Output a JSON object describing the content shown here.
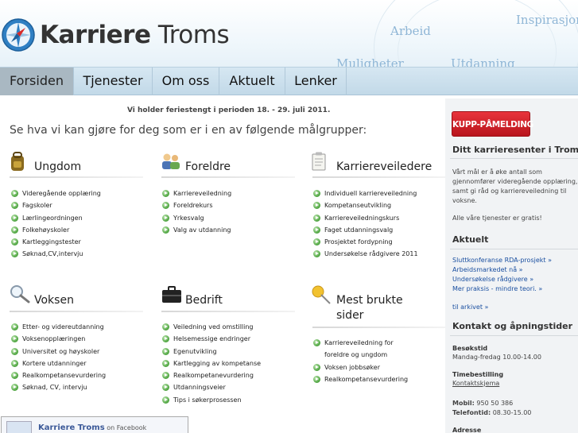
{
  "header": {
    "logo_bold": "Karriere",
    "logo_rest": " Troms",
    "words": [
      "Inspirasjon",
      "Arbeid",
      "Muligheter",
      "Utdanning"
    ]
  },
  "nav": [
    "Forsiden",
    "Tjenester",
    "Om oss",
    "Aktuelt",
    "Lenker"
  ],
  "notice": "Vi holder feriestengt i perioden 18. - 29. juli 2011.",
  "intro": "Se hva vi kan gjøre for deg som er i en av følgende målgrupper:",
  "groups": {
    "ungdom": {
      "title": "Ungdom",
      "icon": "backpack-icon",
      "links": [
        "Videregående opplæring",
        "Fagskoler",
        "Lærlingeordningen",
        "Folkehøyskoler",
        "Kartleggingstester",
        "Søknad,CV,intervju"
      ]
    },
    "foreldre": {
      "title": "Foreldre",
      "icon": "parents-icon",
      "links": [
        "Karriereveiledning",
        "Foreldrekurs",
        "Yrkesvalg",
        "Valg av utdanning"
      ]
    },
    "veiledere": {
      "title": "Karriereveiledere",
      "icon": "clipboard-icon",
      "links": [
        "Individuell karriereveiledning",
        "Kompetanseutvikling",
        "Karriereveiledningskurs",
        "Faget utdanningsvalg",
        "Prosjektet fordypning",
        "Undersøkelse rådgivere 2011"
      ]
    },
    "voksen": {
      "title": "Voksen",
      "icon": "magnifier-icon",
      "links": [
        "Etter- og videreutdanning",
        "Voksenopplæringen",
        "Universitet og høyskoler",
        "Kortere utdanninger",
        "Realkompetansevurdering",
        "Søknad, CV, intervju"
      ]
    },
    "bedrift": {
      "title": "Bedrift",
      "icon": "briefcase-icon",
      "links": [
        "Veiledning ved omstilling",
        "Helsemessige endringer",
        "Egenutvikling",
        "Kartlegging av kompetanse",
        "Realkompetanevurdering",
        "Utdanningsveier",
        "Tips i søkerprosessen"
      ]
    },
    "mest": {
      "title_line1": "Mest brukte",
      "title_line2": "sider",
      "icon": "pushpin-icon",
      "links": [
        "Karriereveiledning for",
        "foreldre og ungdom",
        "Voksen jobbsøker",
        "Realkompetansevurdering"
      ]
    }
  },
  "facebook": {
    "name": "Karriere Troms",
    "suffix": " on Facebook"
  },
  "sidebar": {
    "kupp_label": "KUPP-PÅMELDING",
    "karriere_heading": "Ditt karrieresenter i Troms",
    "karriere_text": [
      "Vårt mål er å øke antall som",
      "gjennomfører videregående opplæring,",
      "samt gi råd og karriereveiledning til",
      "voksne."
    ],
    "gratis": "Alle våre tjenester er gratis!",
    "aktuelt_heading": "Aktuelt",
    "aktuelt_links": [
      "Sluttkonferanse RDA-prosjekt »",
      "Arbeidsmarkedet nå »",
      "Undersøkelse rådgivere »",
      "Mer praksis - mindre teori. »"
    ],
    "arkiv": "til arkivet »",
    "kontakt_heading": "Kontakt og åpningstider",
    "besokstid_label": "Besøkstid",
    "besokstid_value": "Mandag-fredag 10.00-14.00",
    "timebestilling_label": "Timebestilling",
    "kontaktskjema": "Kontaktskjema",
    "mobil_label": "Mobil:",
    "mobil_value": " 950 50 386",
    "telefontid_label": "Telefontid:",
    "telefontid_value": " 08.30-15.00",
    "adresse_label": "Adresse"
  }
}
